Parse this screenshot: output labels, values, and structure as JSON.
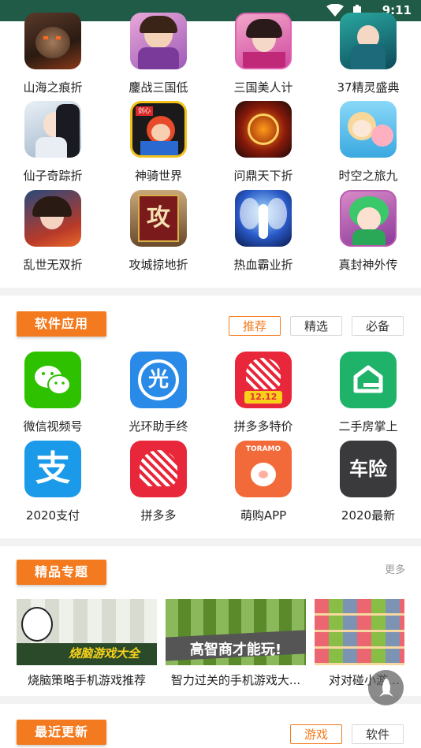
{
  "status": {
    "time": "9:11"
  },
  "games": [
    {
      "label": "山海之痕折",
      "icon": "game-icon-beast"
    },
    {
      "label": "鏖战三国低",
      "icon": "game-icon-warrior-woman"
    },
    {
      "label": "三国美人计",
      "icon": "game-icon-beauty"
    },
    {
      "label": "37精灵盛典",
      "icon": "game-icon-elf"
    },
    {
      "label": "仙子奇踪折",
      "icon": "game-icon-fairy"
    },
    {
      "label": "神骑世界",
      "icon": "game-icon-knight"
    },
    {
      "label": "问鼎天下折",
      "icon": "game-icon-dragon"
    },
    {
      "label": "时空之旅九",
      "icon": "game-icon-travel"
    },
    {
      "label": "乱世无双折",
      "icon": "game-icon-heroine"
    },
    {
      "label": "攻城掠地折",
      "icon": "game-icon-siege"
    },
    {
      "label": "热血霸业折",
      "icon": "game-icon-angel"
    },
    {
      "label": "真封神外传",
      "icon": "game-icon-green-girl"
    }
  ],
  "apps_section": {
    "title": "软件应用",
    "filters": [
      "推荐",
      "精选",
      "必备"
    ],
    "active_filter": "推荐"
  },
  "apps": [
    {
      "label": "微信视频号",
      "icon": "wechat-icon"
    },
    {
      "label": "光环助手终",
      "icon": "guanghuan-icon",
      "glyph": "光"
    },
    {
      "label": "拼多多特价",
      "icon": "pinduoduo-1212-icon",
      "badge": "12.12"
    },
    {
      "label": "二手房掌上",
      "icon": "house-icon"
    },
    {
      "label": "2020支付",
      "icon": "alipay-icon",
      "glyph": "支"
    },
    {
      "label": "拼多多",
      "icon": "pinduoduo-icon"
    },
    {
      "label": "萌购APP",
      "icon": "toramo-icon",
      "brand": "TORAMO"
    },
    {
      "label": "2020最新",
      "icon": "car-insurance-icon",
      "glyph": "车险"
    }
  ],
  "topics_section": {
    "title": "精品专题",
    "more": "更多",
    "cards": [
      {
        "label": "烧脑策略手机游戏推荐",
        "caption": "烧脑游戏大全"
      },
      {
        "label": "智力过关的手机游戏大...",
        "caption": "高智商才能玩!"
      },
      {
        "label": "对对碰小游戏大全",
        "caption": ""
      }
    ]
  },
  "recent_section": {
    "title": "最近更新",
    "filters": [
      "游戏",
      "软件"
    ],
    "active_filter": "游戏"
  },
  "colors": {
    "accent": "#f47a1f",
    "statusbar": "#1f5b46"
  }
}
